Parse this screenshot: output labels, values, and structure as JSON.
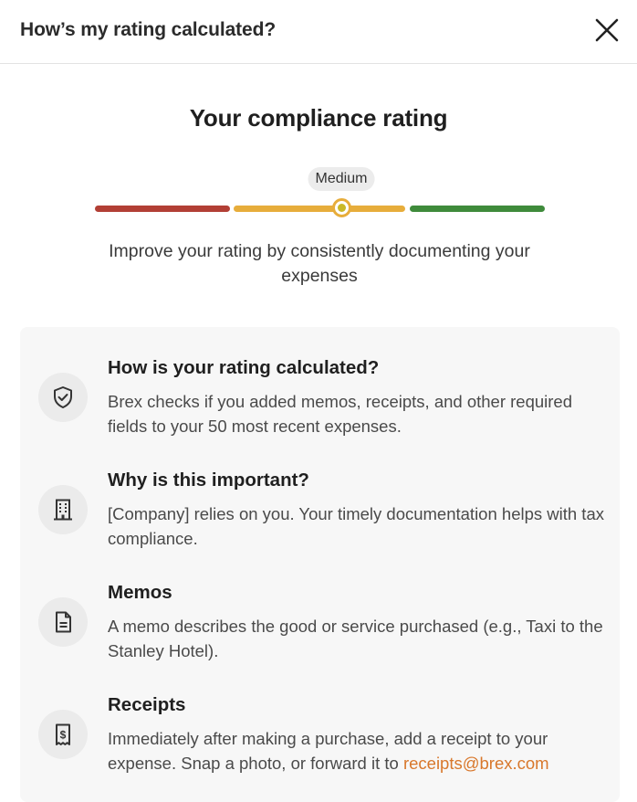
{
  "header": {
    "title": "How’s my rating calculated?",
    "close_icon": "close-icon"
  },
  "rating": {
    "title": "Your compliance rating",
    "level": "Medium",
    "level_value_fraction": 0.55,
    "scale_colors": [
      "#b23f35",
      "#e7ad3b",
      "#3f8b3b"
    ],
    "message": "Improve your rating by consistently documenting your expenses"
  },
  "info": {
    "items": [
      {
        "icon": "shield-check-icon",
        "title": "How is your rating calculated?",
        "body": "Brex checks if you added memos, receipts, and other required fields to your 50 most recent expenses."
      },
      {
        "icon": "building-icon",
        "title": "Why is this important?",
        "body": "[Company] relies on you. Your timely documentation helps with tax compliance."
      },
      {
        "icon": "document-icon",
        "title": "Memos",
        "body": "A memo describes the good or service purchased (e.g., Taxi to the Stanley Hotel)."
      },
      {
        "icon": "receipt-icon",
        "title": "Receipts",
        "body_prefix": "Immediately after making a purchase, add a receipt to your expense. Snap a photo, or forward it to ",
        "link_text": "receipts@brex.com"
      }
    ]
  },
  "colors": {
    "link": "#d8772b",
    "card_bg": "#f7f7f7"
  }
}
